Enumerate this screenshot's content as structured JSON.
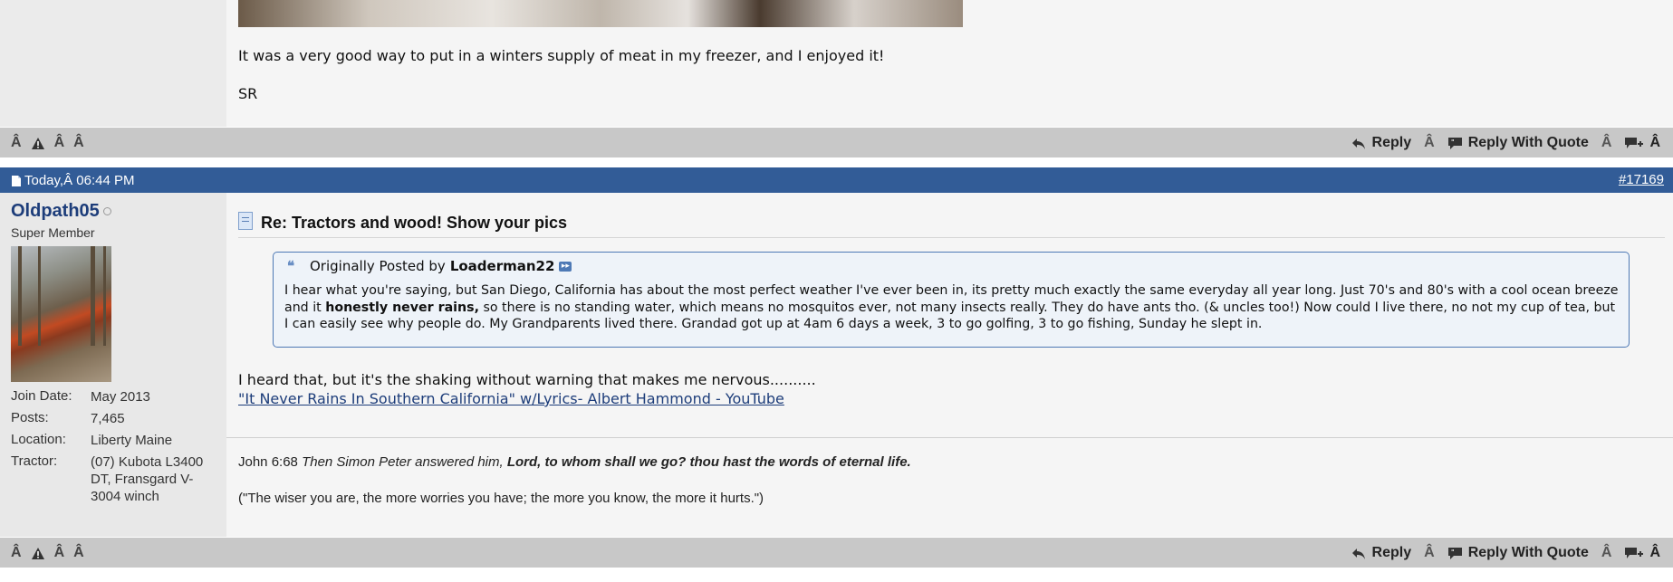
{
  "prev_post": {
    "line1": "It was a very good way to put in a winters supply of meat in my freezer, and I enjoyed it!",
    "line2": "SR"
  },
  "action_bar": {
    "left_glyphs": [
      "Â",
      "Â",
      "Â"
    ],
    "reply_label": "Reply",
    "reply_sep": "Â",
    "reply_quote_label": "Reply With Quote",
    "reply_quote_sep": "Â",
    "multiquote_sep": "Â"
  },
  "post_header": {
    "date": "Today,Â 06:44 PM",
    "post_number": "#17169"
  },
  "user": {
    "name": "Oldpath05",
    "title": "Super Member",
    "join_label": "Join Date:",
    "join_value": "May 2013",
    "posts_label": "Posts:",
    "posts_value": "7,465",
    "location_label": "Location:",
    "location_value": "Liberty Maine",
    "tractor_label": "Tractor:",
    "tractor_value": "(07) Kubota L3400 DT, Fransgard V-3004 winch"
  },
  "post": {
    "title": "Re: Tractors and wood! Show your pics",
    "quote_prefix": "Originally Posted by",
    "quote_author": "Loaderman22",
    "quote_text_1": "I hear what you're saying, but San Diego, California has about the most perfect weather I've ever been in, its pretty much exactly the same everyday all year long. Just 70's and 80's with a cool ocean breeze and it ",
    "quote_text_bold": "honestly never rains,",
    "quote_text_2": " so there is no standing water, which means no mosquitos ever, not many insects really. They do have ants tho. (& uncles too!) Now could I live there, no not my cup of tea, but I can easily see why people do. My Grandparents lived there. Grandad got up at 4am 6 days a week, 3 to go golfing, 3 to go fishing, Sunday he slept in.",
    "message": "I heard that, but it's the shaking without warning that makes me nervous..........",
    "link_text": "\"It Never Rains In Southern California\" w/Lyrics- Albert Hammond - YouTube"
  },
  "signature": {
    "ref": "John 6:68",
    "italic": "Then Simon Peter answered him,",
    "bold_italic": "Lord, to whom shall we go? thou hast the words of eternal life.",
    "line2": "(\"The wiser you are, the more worries you have; the more you know, the more it hurts.\")"
  },
  "colors": {
    "header_bg": "#325c97",
    "action_bar_bg": "#c8c8c8",
    "link": "#1d3d7a"
  }
}
